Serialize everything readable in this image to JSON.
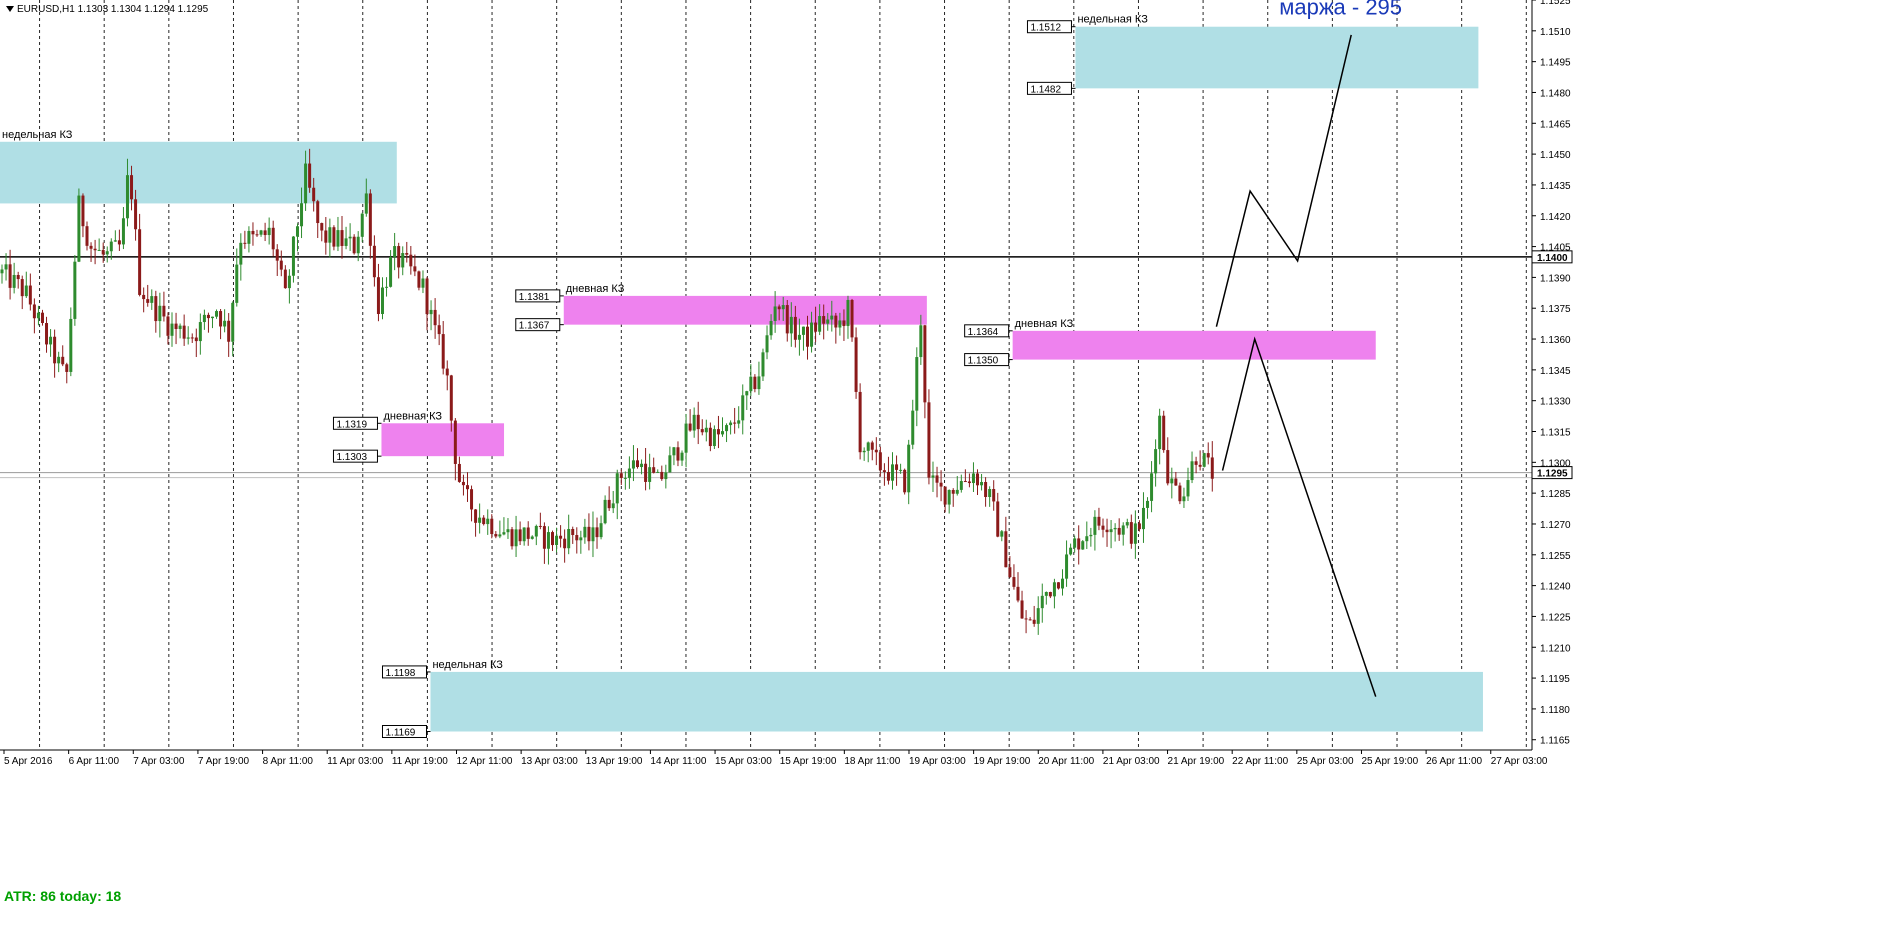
{
  "header": {
    "symbol_line": "EURUSD,H1  1.1303 1.1304 1.1294 1.1295"
  },
  "indicator": {
    "atr_text": "ATR: 86  today: 18"
  },
  "colors": {
    "bull": "#2e8b2e",
    "bear": "#8b1a1a",
    "weekly_zone": "#b0dfe5",
    "daily_zone": "#ee82ee",
    "atr_text": "#00a000",
    "annotation_text": "#1a3ab8"
  },
  "chart_data": {
    "type": "candlestick",
    "ylim": [
      1.116,
      1.1525
    ],
    "y_ticks": [
      "1.1525",
      "1.1510",
      "1.1495",
      "1.1480",
      "1.1465",
      "1.1450",
      "1.1435",
      "1.1420",
      "1.1405",
      "1.1390",
      "1.1375",
      "1.1360",
      "1.1345",
      "1.1330",
      "1.1315",
      "1.1300",
      "1.1285",
      "1.1270",
      "1.1255",
      "1.1240",
      "1.1225",
      "1.1210",
      "1.1195",
      "1.1180",
      "1.1165"
    ],
    "x_tick_labels": [
      "5 Apr 2016",
      "6 Apr 11:00",
      "7 Apr 03:00",
      "7 Apr 19:00",
      "8 Apr 11:00",
      "11 Apr 03:00",
      "11 Apr 19:00",
      "12 Apr 11:00",
      "13 Apr 03:00",
      "13 Apr 19:00",
      "14 Apr 11:00",
      "15 Apr 03:00",
      "15 Apr 19:00",
      "18 Apr 11:00",
      "19 Apr 03:00",
      "19 Apr 19:00",
      "20 Apr 11:00",
      "21 Apr 03:00",
      "21 Apr 19:00",
      "22 Apr 11:00",
      "25 Apr 03:00",
      "25 Apr 19:00",
      "26 Apr 11:00",
      "27 Apr 03:00"
    ],
    "current_price": "1.1295",
    "horizontal_level": "1.1400",
    "zones": [
      {
        "label": "недельная КЗ",
        "kind": "weekly",
        "top": 1.1456,
        "bottom": 1.1426,
        "x_from": 0.0,
        "x_to": 0.259,
        "top_tag": "",
        "bottom_tag": ""
      },
      {
        "label": "недельная КЗ",
        "kind": "weekly",
        "top": 1.1512,
        "bottom": 1.1482,
        "x_from": 0.702,
        "x_to": 0.965,
        "top_tag": "1.1512",
        "bottom_tag": "1.1482"
      },
      {
        "label": "недельная КЗ",
        "kind": "weekly",
        "top": 1.1198,
        "bottom": 1.1169,
        "x_from": 0.281,
        "x_to": 0.968,
        "top_tag": "1.1198",
        "bottom_tag": "1.1169"
      },
      {
        "label": "дневная КЗ",
        "kind": "daily",
        "top": 1.1381,
        "bottom": 1.1367,
        "x_from": 0.368,
        "x_to": 0.605,
        "top_tag": "1.1381",
        "bottom_tag": "1.1367"
      },
      {
        "label": "дневная КЗ",
        "kind": "daily",
        "top": 1.1319,
        "bottom": 1.1303,
        "x_from": 0.249,
        "x_to": 0.329,
        "top_tag": "1.1319",
        "bottom_tag": "1.1303"
      },
      {
        "label": "дневная КЗ",
        "kind": "daily",
        "top": 1.1364,
        "bottom": 1.135,
        "x_from": 0.661,
        "x_to": 0.898,
        "top_tag": "1.1364",
        "bottom_tag": "1.1350"
      }
    ],
    "forecast_paths": [
      {
        "points": [
          [
            0.798,
            1.1296
          ],
          [
            0.819,
            1.136
          ],
          [
            0.898,
            1.1186
          ]
        ]
      },
      {
        "points": [
          [
            0.794,
            1.1366
          ],
          [
            0.816,
            1.1432
          ],
          [
            0.847,
            1.1398
          ],
          [
            0.882,
            1.1508
          ]
        ]
      }
    ],
    "annotation": "маржа - 295",
    "price_path": [
      [
        0.0,
        1.1392
      ],
      [
        0.015,
        1.1383
      ],
      [
        0.03,
        1.1358
      ],
      [
        0.042,
        1.134
      ],
      [
        0.05,
        1.1425
      ],
      [
        0.058,
        1.1405
      ],
      [
        0.067,
        1.14
      ],
      [
        0.078,
        1.1405
      ],
      [
        0.083,
        1.1445
      ],
      [
        0.09,
        1.1385
      ],
      [
        0.1,
        1.1375
      ],
      [
        0.11,
        1.1366
      ],
      [
        0.125,
        1.1362
      ],
      [
        0.14,
        1.1375
      ],
      [
        0.148,
        1.1362
      ],
      [
        0.155,
        1.141
      ],
      [
        0.165,
        1.1408
      ],
      [
        0.175,
        1.1412
      ],
      [
        0.185,
        1.138
      ],
      [
        0.198,
        1.144
      ],
      [
        0.208,
        1.141
      ],
      [
        0.22,
        1.1408
      ],
      [
        0.23,
        1.1405
      ],
      [
        0.238,
        1.143
      ],
      [
        0.245,
        1.1375
      ],
      [
        0.255,
        1.14
      ],
      [
        0.265,
        1.1395
      ],
      [
        0.275,
        1.1385
      ],
      [
        0.282,
        1.1365
      ],
      [
        0.29,
        1.1345
      ],
      [
        0.295,
        1.1308
      ],
      [
        0.3,
        1.1285
      ],
      [
        0.31,
        1.1275
      ],
      [
        0.32,
        1.127
      ],
      [
        0.33,
        1.1265
      ],
      [
        0.345,
        1.1265
      ],
      [
        0.36,
        1.1262
      ],
      [
        0.372,
        1.1265
      ],
      [
        0.385,
        1.1262
      ],
      [
        0.395,
        1.128
      ],
      [
        0.405,
        1.1295
      ],
      [
        0.415,
        1.13
      ],
      [
        0.428,
        1.129
      ],
      [
        0.44,
        1.1305
      ],
      [
        0.452,
        1.132
      ],
      [
        0.465,
        1.1312
      ],
      [
        0.475,
        1.1315
      ],
      [
        0.485,
        1.133
      ],
      [
        0.495,
        1.1345
      ],
      [
        0.505,
        1.138
      ],
      [
        0.515,
        1.1365
      ],
      [
        0.525,
        1.136
      ],
      [
        0.535,
        1.137
      ],
      [
        0.545,
        1.1365
      ],
      [
        0.553,
        1.1375
      ],
      [
        0.56,
        1.131
      ],
      [
        0.57,
        1.13
      ],
      [
        0.58,
        1.1295
      ],
      [
        0.59,
        1.129
      ],
      [
        0.6,
        1.1372
      ],
      [
        0.605,
        1.129
      ],
      [
        0.615,
        1.1285
      ],
      [
        0.625,
        1.129
      ],
      [
        0.635,
        1.1295
      ],
      [
        0.645,
        1.1282
      ],
      [
        0.655,
        1.1255
      ],
      [
        0.665,
        1.1225
      ],
      [
        0.672,
        1.122
      ],
      [
        0.68,
        1.1235
      ],
      [
        0.69,
        1.1245
      ],
      [
        0.7,
        1.126
      ],
      [
        0.71,
        1.1268
      ],
      [
        0.72,
        1.1272
      ],
      [
        0.73,
        1.1268
      ],
      [
        0.74,
        1.1265
      ],
      [
        0.748,
        1.128
      ],
      [
        0.755,
        1.1325
      ],
      [
        0.762,
        1.129
      ],
      [
        0.77,
        1.1285
      ],
      [
        0.78,
        1.1305
      ],
      [
        0.79,
        1.1295
      ]
    ]
  }
}
